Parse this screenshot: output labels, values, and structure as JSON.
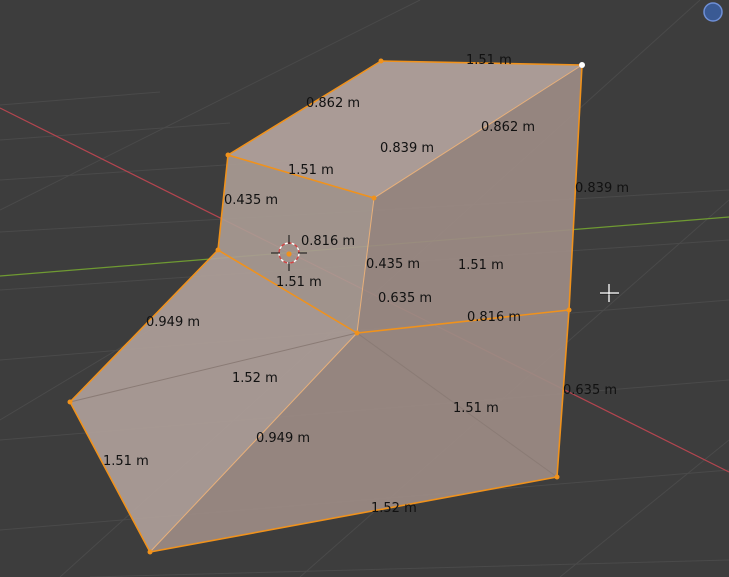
{
  "viewport": {
    "background": "#3d3d3d",
    "grid_color": "#4a4a4a",
    "x_axis_color": "#b4454f",
    "y_axis_color": "#6f9a32",
    "selection_edge_color": "#f0921c",
    "vertex_color": "#f0921c",
    "active_vertex_color": "#ffffff",
    "face_color": "#b3a39d"
  },
  "measurements": {
    "top_back_edge": "1.51 m",
    "top_left_edge": "0.862 m",
    "top_right_edge": "0.862 m",
    "top_face_depth": "0.839 m",
    "top_front_edge": "1.51 m",
    "step_riser_left": "0.435 m",
    "step_riser_right": "0.435 m",
    "step_depth": "0.816 m",
    "step_front_edge": "1.51 m",
    "right_vertical_upper": "0.839 m",
    "right_face_width": "1.51 m",
    "diagonal_center": "0.635 m",
    "lower_depth": "0.816 m",
    "slope_left": "0.949 m",
    "slope_face_width": "1.52 m",
    "slope_right": "0.949 m",
    "right_vertical_lower": "0.635 m",
    "lower_right_face_width": "1.51 m",
    "front_left_edge": "1.51 m",
    "bottom_edge": "1.52 m"
  },
  "icons": {
    "gizmo": "navigation-gizmo-icon",
    "cursor": "crosshair-cursor-icon",
    "origin": "3d-cursor-icon"
  }
}
